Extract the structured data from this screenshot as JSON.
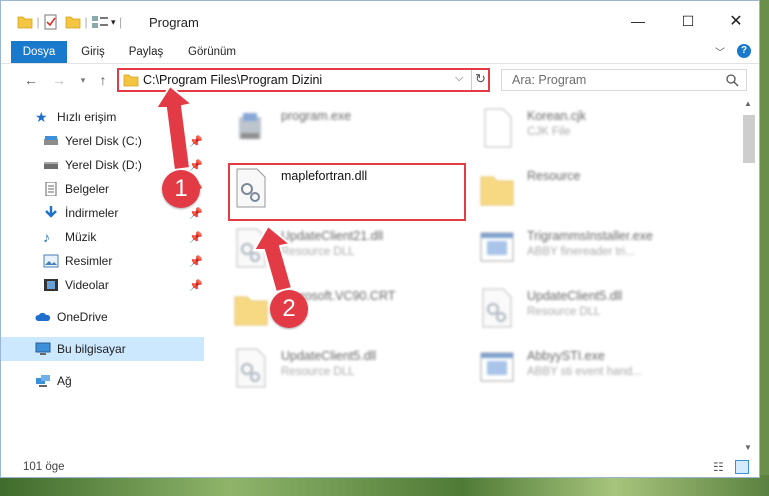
{
  "window": {
    "title": "Program"
  },
  "ribbon": {
    "tabs": [
      "Dosya",
      "Giriş",
      "Paylaş",
      "Görünüm"
    ]
  },
  "address": {
    "path": "C:\\Program Files\\Program Dizini"
  },
  "search": {
    "placeholder": "Ara: Program"
  },
  "sidebar": {
    "items": [
      {
        "label": "Hızlı erişim",
        "icon": "star-icon"
      },
      {
        "label": "Yerel Disk (C:)",
        "icon": "drive-icon",
        "pinned": true
      },
      {
        "label": "Yerel Disk (D:)",
        "icon": "drive-icon",
        "pinned": true
      },
      {
        "label": "Belgeler",
        "icon": "document-icon",
        "pinned": true
      },
      {
        "label": "İndirmeler",
        "icon": "download-icon",
        "pinned": true
      },
      {
        "label": "Müzik",
        "icon": "music-icon",
        "pinned": true
      },
      {
        "label": "Resimler",
        "icon": "picture-icon",
        "pinned": true
      },
      {
        "label": "Videolar",
        "icon": "video-icon",
        "pinned": true
      },
      {
        "label": "OneDrive",
        "icon": "cloud-icon"
      },
      {
        "label": "Bu bilgisayar",
        "icon": "computer-icon",
        "selected": true
      },
      {
        "label": "Ağ",
        "icon": "network-icon"
      }
    ]
  },
  "files": [
    {
      "name": "program.exe",
      "desc": "",
      "icon": "installer-icon"
    },
    {
      "name": "Korean.cjk",
      "desc": "CJK File",
      "icon": "file-icon"
    },
    {
      "name": "maplefortran.dll",
      "desc": "",
      "icon": "dll-gear-icon"
    },
    {
      "name": "Resource",
      "desc": "",
      "icon": "folder-icon"
    },
    {
      "name": "UpdateClient21.dll",
      "desc": "Resource DLL",
      "icon": "dll-gear-icon"
    },
    {
      "name": "TrigrammsInstaller.exe",
      "desc": "ABBY finereader tri...",
      "icon": "app-icon"
    },
    {
      "name": "Microsoft.VC90.CRT",
      "desc": "",
      "icon": "folder-icon"
    },
    {
      "name": "UpdateClient5.dll",
      "desc": "Resource DLL",
      "icon": "dll-gear-icon"
    },
    {
      "name": "UpdateClient5.dll",
      "desc": "Resource DLL",
      "icon": "dll-gear-icon"
    },
    {
      "name": "AbbyySTI.exe",
      "desc": "ABBY sti event hand...",
      "icon": "app-icon"
    }
  ],
  "status": {
    "count": "101 öge"
  },
  "annotations": {
    "step1": "1",
    "step2": "2"
  },
  "colors": {
    "accent": "#1979ca",
    "highlight": "#e23b45",
    "selection": "#cce8ff"
  }
}
